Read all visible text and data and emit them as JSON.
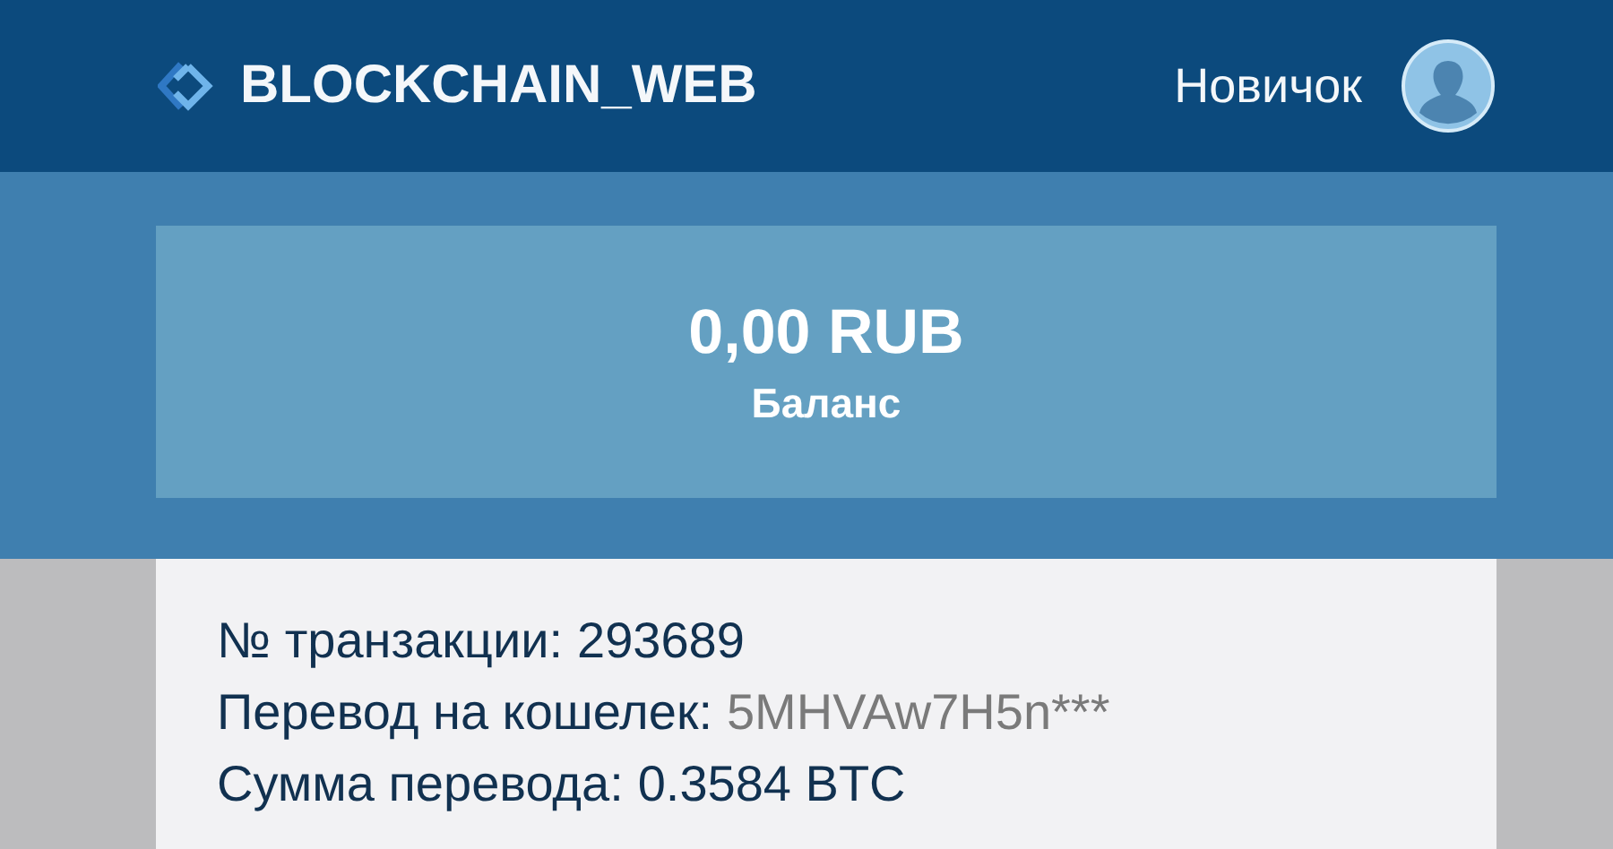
{
  "header": {
    "title": "BLOCKCHAIN_WEB",
    "user": "Новичок"
  },
  "balance": {
    "amount": "0,00 RUB",
    "label": "Баланс"
  },
  "transaction": [
    {
      "label": "№ транзакции:",
      "value": "293689",
      "muted": false
    },
    {
      "label": "Перевод на кошелек:",
      "value": "5MHVAw7H5n***",
      "muted": true
    },
    {
      "label": "Сумма перевода:",
      "value": "0.3584 BTC",
      "muted": false
    }
  ]
}
